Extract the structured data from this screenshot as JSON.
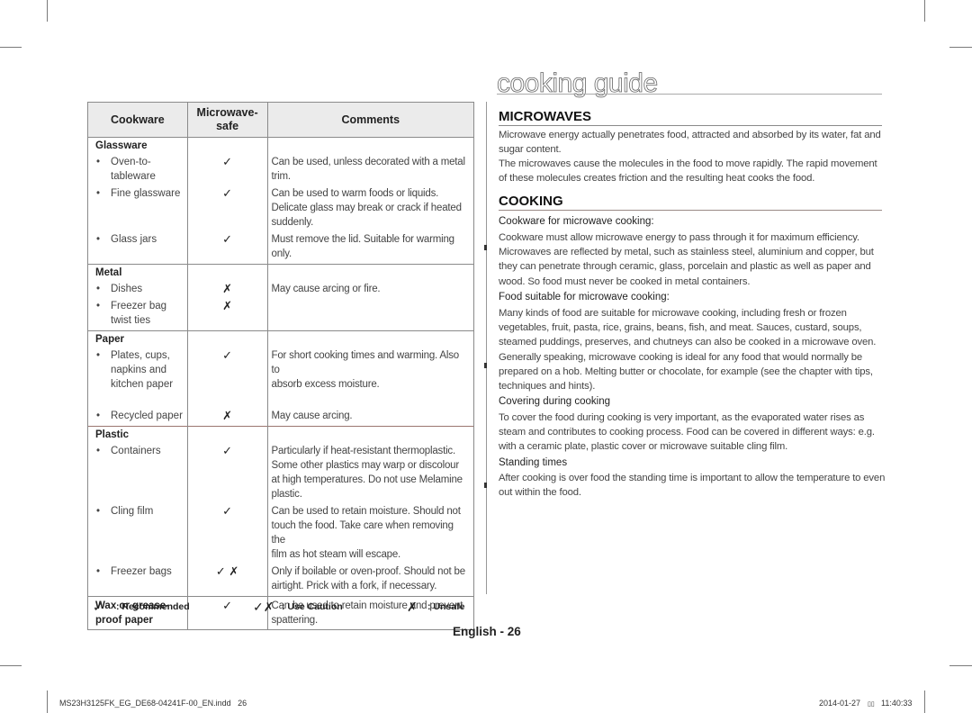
{
  "page": {
    "title": "cooking guide",
    "page_label": "English - 26"
  },
  "table": {
    "headers": {
      "cookware": "Cookware",
      "microwave_safe_line1": "Microwave-",
      "microwave_safe_line2": "safe",
      "comments": "Comments"
    },
    "sections": [
      {
        "group": "Glassware",
        "items": [
          {
            "name": [
              "Oven-to-",
              "tableware"
            ],
            "mark": "✓",
            "comment": [
              "Can be used, unless decorated with a metal",
              "trim."
            ]
          },
          {
            "name": [
              "Fine glassware"
            ],
            "mark": "✓",
            "comment": [
              "Can be used to warm foods or liquids.",
              "Delicate glass may break or crack if heated",
              "suddenly."
            ]
          },
          {
            "name": [
              "Glass jars"
            ],
            "mark": "✓",
            "comment": [
              "Must remove the lid. Suitable for warming",
              "only."
            ]
          }
        ]
      },
      {
        "group": "Metal",
        "items": [
          {
            "name": [
              "Dishes"
            ],
            "mark": "✗",
            "comment": [
              "May cause arcing or fire."
            ]
          },
          {
            "name": [
              "Freezer bag",
              "twist ties"
            ],
            "mark": "✗",
            "comment": []
          }
        ]
      },
      {
        "group": "Paper",
        "items": [
          {
            "name": [
              "Plates, cups,",
              "napkins and",
              "kitchen paper"
            ],
            "mark": "✓",
            "comment": [
              "For short cooking times and warming. Also to",
              "absorb excess moisture."
            ]
          },
          {
            "name": [
              "Recycled paper"
            ],
            "mark": "✗",
            "comment": [
              "May cause arcing."
            ]
          }
        ]
      },
      {
        "group": "Plastic",
        "items": [
          {
            "name": [
              "Containers"
            ],
            "mark": "✓",
            "comment": [
              "Particularly if heat-resistant thermoplastic.",
              "Some other plastics may warp or discolour",
              "at high temperatures. Do not use Melamine",
              "plastic."
            ]
          },
          {
            "name": [
              "Cling film"
            ],
            "mark": "✓",
            "comment": [
              "Can be used to retain moisture. Should not",
              "touch the food. Take care when removing the",
              "film as hot steam will escape."
            ]
          },
          {
            "name": [
              "Freezer bags"
            ],
            "mark": "✓ ✗",
            "comment": [
              "Only if boilable or oven-proof. Should not be",
              "airtight. Prick with a fork, if necessary."
            ]
          }
        ]
      }
    ],
    "last_row": {
      "name": [
        "Wax or grease-",
        "proof paper"
      ],
      "mark": "✓",
      "comment": [
        "Can be used to retain moisture and prevent",
        "spattering."
      ]
    }
  },
  "legend": {
    "recommended": {
      "symbol": "✓",
      "label": ": Recommended"
    },
    "caution": {
      "symbol": "✓✗",
      "label": ": Use Caution"
    },
    "unsafe": {
      "symbol": "✗",
      "label": ": Unsafe"
    }
  },
  "microwaves": {
    "heading": "MICROWAVES",
    "para1": "Microwave energy actually penetrates food, attracted and absorbed by its water, fat and sugar content.",
    "para2": "The microwaves cause the molecules in the food to move rapidly. The rapid movement of these molecules creates friction and the resulting heat cooks the food."
  },
  "cooking": {
    "heading": "COOKING",
    "sections": [
      {
        "title": "Cookware for microwave cooking:",
        "text": "Cookware must allow microwave energy to pass through it for maximum efficiency. Microwaves are reflected by metal, such as stainless steel, aluminium and copper, but they can penetrate through ceramic, glass, porcelain and plastic as well as paper and wood. So food must never be cooked in metal containers."
      },
      {
        "title": "Food suitable for microwave cooking:",
        "text": "Many kinds of food are suitable for microwave cooking, including fresh or frozen vegetables, fruit, pasta, rice, grains, beans, fish, and meat. Sauces, custard, soups, steamed puddings, preserves, and chutneys can also be cooked in a microwave oven. Generally speaking, microwave cooking is ideal for any food that would normally be prepared on a hob. Melting butter or chocolate, for example (see the chapter with tips, techniques and hints)."
      },
      {
        "title": "Covering during cooking",
        "text": "To cover the food during cooking is very important, as the evaporated water rises as steam and contributes to cooking process. Food can be covered in different ways: e.g. with a ceramic plate, plastic cover or microwave suitable cling film."
      },
      {
        "title": "Standing times",
        "text": "After cooking is over food the standing time is important to allow the temperature to even out within the food."
      }
    ]
  },
  "footer": {
    "filename": "MS23H3125FK_EG_DE68-04241F-00_EN.indd   26",
    "date": "2014-01-27",
    "time_glyph": "▯▯",
    "time": "11:40:33"
  }
}
